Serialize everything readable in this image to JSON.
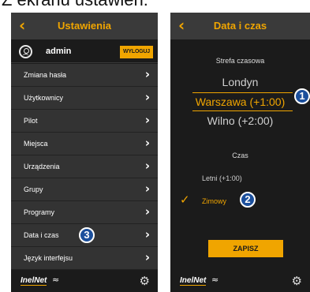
{
  "caption": "Z ekranu ustawień:",
  "left_screen": {
    "title": "Ustawienia",
    "user": {
      "name": "admin",
      "logout_label": "WYLOGUJ"
    },
    "menu": [
      {
        "label": "Zmiana hasła"
      },
      {
        "label": "Użytkownicy"
      },
      {
        "label": "Pilot"
      },
      {
        "label": "Miejsca"
      },
      {
        "label": "Urządzenia"
      },
      {
        "label": "Grupy"
      },
      {
        "label": "Programy"
      },
      {
        "label": "Data i czas"
      },
      {
        "label": "Język interfejsu"
      }
    ],
    "logo": "InelNet"
  },
  "right_screen": {
    "title": "Data i czas",
    "timezone_heading": "Strefa czasowa",
    "timezones": [
      "Londyn",
      "Warszawa (+1:00)",
      "Wilno (+2:00)"
    ],
    "selected_timezone": "Warszawa (+1:00)",
    "time_heading": "Czas",
    "season_options": [
      "Letni (+1:00)",
      "Zimowy"
    ],
    "selected_season": "Zimowy",
    "save_label": "ZAPISZ",
    "logo": "InelNet"
  },
  "badges": [
    "1",
    "2",
    "3"
  ],
  "colors": {
    "accent": "#f0a500",
    "background": "#1b1b1b",
    "menu_item": "#333333",
    "badge": "#1b4f9c"
  },
  "icons": [
    "back-chevron-icon",
    "user-icon",
    "chevron-right-icon",
    "wifi-icon",
    "gear-icon",
    "checkmark-icon"
  ]
}
